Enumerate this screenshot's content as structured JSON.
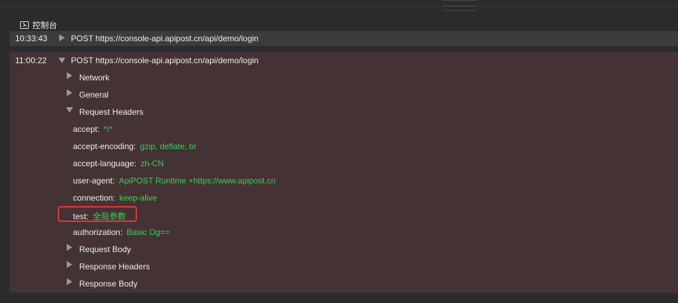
{
  "console": {
    "title": "控制台"
  },
  "logs": [
    {
      "time": "10:33:43",
      "request": "POST https://console-api.apipost.cn/api/demo/login",
      "expanded": false
    },
    {
      "time": "11:00:22",
      "request": "POST https://console-api.apipost.cn/api/demo/login",
      "expanded": true,
      "sections": {
        "network": "Network",
        "general": "General",
        "request_headers": "Request Headers",
        "request_body": "Request Body",
        "response_headers": "Response Headers",
        "response_body": "Response Body"
      },
      "headers": [
        {
          "key": "accept:",
          "value": "*/*"
        },
        {
          "key": "accept-encoding:",
          "value": "gzip, deflate, br"
        },
        {
          "key": "accept-language:",
          "value": "zh-CN"
        },
        {
          "key": "user-agent:",
          "value": "ApiPOST Runtime +https://www.apipost.cn"
        },
        {
          "key": "connection:",
          "value": "keep-alive"
        },
        {
          "key": "test:",
          "value": "全局参数"
        },
        {
          "key": "authorization:",
          "value": "Basic Og=="
        }
      ]
    }
  ],
  "colors": {
    "background": "#2b2b2d",
    "collapsed_row": "#3c3c3e",
    "expanded_row": "#443234",
    "header_value": "#3fcf5a",
    "highlight": "#e03a3a"
  },
  "icons": {
    "console": "terminal-icon",
    "collapsed": "triangle-right-icon",
    "expanded": "triangle-down-icon"
  }
}
